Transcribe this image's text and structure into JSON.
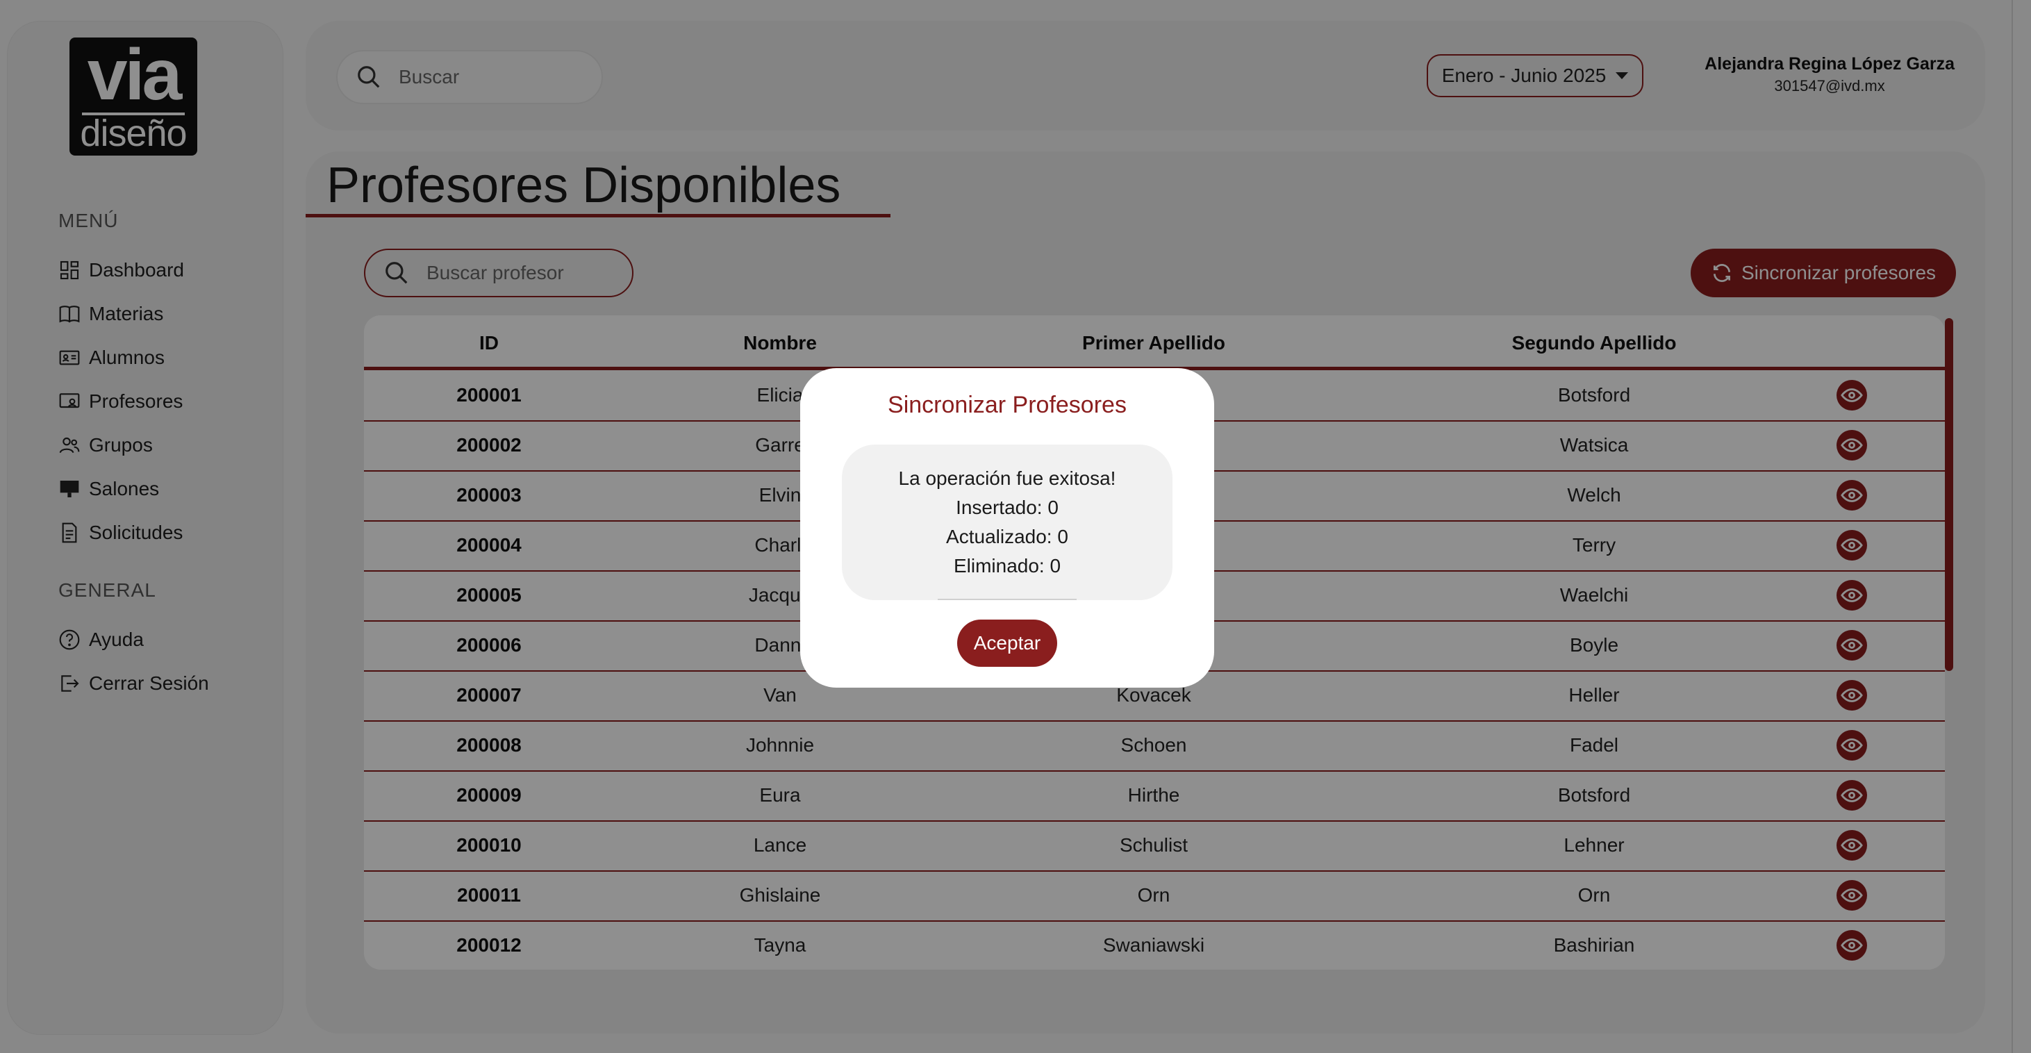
{
  "brand": {
    "logo_top": "via",
    "logo_bottom": "diseño"
  },
  "sidebar": {
    "menu_label": "MENÚ",
    "general_label": "GENERAL",
    "menu_items": [
      {
        "label": "Dashboard",
        "icon": "dashboard-icon"
      },
      {
        "label": "Materias",
        "icon": "book-icon"
      },
      {
        "label": "Alumnos",
        "icon": "id-card-icon"
      },
      {
        "label": "Profesores",
        "icon": "teacher-icon"
      },
      {
        "label": "Grupos",
        "icon": "people-icon"
      },
      {
        "label": "Salones",
        "icon": "classroom-icon"
      },
      {
        "label": "Solicitudes",
        "icon": "document-icon"
      }
    ],
    "general_items": [
      {
        "label": "Ayuda",
        "icon": "help-icon"
      },
      {
        "label": "Cerrar Sesión",
        "icon": "logout-icon"
      }
    ]
  },
  "header": {
    "search_placeholder": "Buscar",
    "period": "Enero - Junio 2025",
    "user_name": "Alejandra Regina López Garza",
    "user_email": "301547@ivd.mx"
  },
  "main": {
    "title": "Profesores Disponibles",
    "search_placeholder": "Buscar profesor",
    "sync_button": "Sincronizar profesores"
  },
  "table": {
    "columns": [
      "ID",
      "Nombre",
      "Primer Apellido",
      "Segundo Apellido"
    ],
    "rows": [
      [
        "200001",
        "Elicia",
        "",
        "Botsford"
      ],
      [
        "200002",
        "Garre",
        "",
        "Watsica"
      ],
      [
        "200003",
        "Elvin",
        "",
        "Welch"
      ],
      [
        "200004",
        "Charli",
        "",
        "Terry"
      ],
      [
        "200005",
        "Jacque",
        "",
        "Waelchi"
      ],
      [
        "200006",
        "Danni",
        "",
        "Boyle"
      ],
      [
        "200007",
        "Van",
        "Kovacek",
        "Heller"
      ],
      [
        "200008",
        "Johnnie",
        "Schoen",
        "Fadel"
      ],
      [
        "200009",
        "Eura",
        "Hirthe",
        "Botsford"
      ],
      [
        "200010",
        "Lance",
        "Schulist",
        "Lehner"
      ],
      [
        "200011",
        "Ghislaine",
        "Orn",
        "Orn"
      ],
      [
        "200012",
        "Tayna",
        "Swaniawski",
        "Bashirian"
      ]
    ]
  },
  "modal": {
    "title": "Sincronizar Profesores",
    "message": "La operación fue exitosa!",
    "inserted": "Insertado: 0",
    "updated": "Actualizado: 0",
    "deleted": "Eliminado: 0",
    "accept": "Aceptar"
  },
  "colors": {
    "accent": "#8a1e1e",
    "overlay": "rgba(0,0,0,0.44)"
  }
}
